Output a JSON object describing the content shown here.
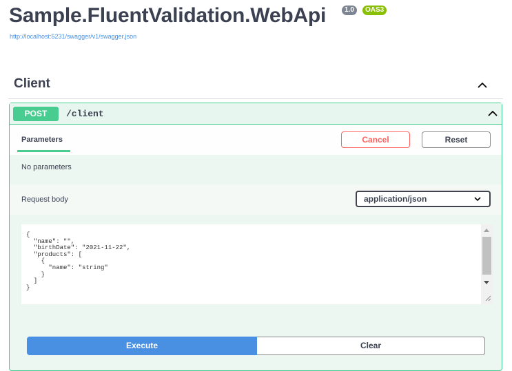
{
  "header": {
    "title": "Sample.FluentValidation.WebApi",
    "version_badge": "1.0",
    "oas_badge": "OAS3",
    "spec_url": "http://localhost:5231/swagger/v1/swagger.json"
  },
  "tag": {
    "name": "Client",
    "chevron_icon": "chevron-up-icon"
  },
  "operation": {
    "method": "POST",
    "path": "/client",
    "chevron_icon": "chevron-up-icon",
    "colors": {
      "accent": "#49cc90",
      "background": "#edf7f1"
    }
  },
  "parameters": {
    "tab_label": "Parameters",
    "cancel_label": "Cancel",
    "reset_label": "Reset",
    "empty_text": "No parameters"
  },
  "request_body": {
    "label": "Request body",
    "content_type": "application/json",
    "body": "{\n  \"name\": \"\",\n  \"birthDate\": \"2021-11-22\",\n  \"products\": [\n    {\n      \"name\": \"string\"\n    }\n  ]\n}"
  },
  "actions": {
    "execute_label": "Execute",
    "clear_label": "Clear",
    "execute_color": "#4990e2"
  }
}
